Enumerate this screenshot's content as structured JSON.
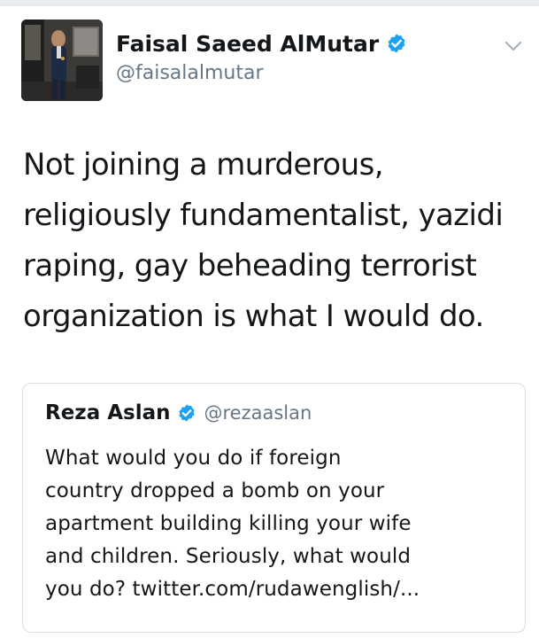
{
  "author": {
    "display_name": "Faisal Saeed AlMutar",
    "handle": "@faisalalmutar",
    "verified": true,
    "avatar_icon": "profile-photo"
  },
  "tweet": {
    "text_lines": [
      "Not joining a murderous,",
      "religiously fundamentalist, yazidi",
      "raping, gay beheading terrorist",
      "organization is what I would do."
    ]
  },
  "quoted_tweet": {
    "display_name": "Reza Aslan",
    "handle": "@rezaaslan",
    "verified": true,
    "text_lines": [
      "What would you do if foreign",
      "country dropped a bomb on your",
      "apartment building killing your wife",
      "and children. Seriously, what would",
      "you do? twitter.com/rudawenglish/..."
    ]
  },
  "menu_icon": "chevron-down-icon",
  "colors": {
    "verified_badge": "#1da1f2",
    "secondary_text": "#657786",
    "primary_text": "#14171a",
    "border": "#d8dee3"
  }
}
